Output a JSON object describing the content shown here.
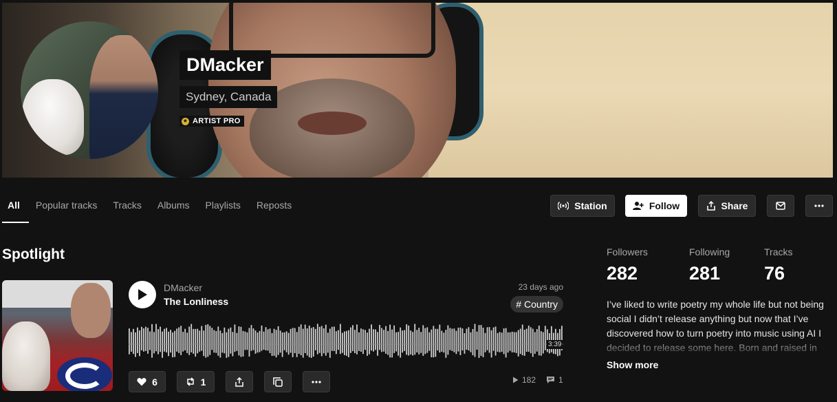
{
  "profile": {
    "name": "DMacker",
    "location": "Sydney, Canada",
    "badge": "ARTIST PRO"
  },
  "tabs": [
    "All",
    "Popular tracks",
    "Tracks",
    "Albums",
    "Playlists",
    "Reposts"
  ],
  "actions": {
    "station": "Station",
    "follow": "Follow",
    "share": "Share"
  },
  "spotlight": {
    "heading": "Spotlight",
    "track": {
      "artist": "DMacker",
      "title": "The Lonliness",
      "date": "23 days ago",
      "tag": "# Country",
      "duration": "3:39",
      "likes": "6",
      "reposts": "1",
      "plays": "182",
      "comments": "1"
    }
  },
  "stats": {
    "followers_label": "Followers",
    "followers": "282",
    "following_label": "Following",
    "following": "281",
    "tracks_label": "Tracks",
    "tracks": "76"
  },
  "bio": {
    "text": "I’ve liked to write poetry my whole life but not being social I didn’t release anything but now that I’ve discovered how to turn poetry into music using AI I decided to release some here. Born and raised in",
    "show_more": "Show more"
  },
  "colors": {
    "background": "#121212",
    "button": "#2a2a2a",
    "waveform": "#cfcfcf"
  }
}
